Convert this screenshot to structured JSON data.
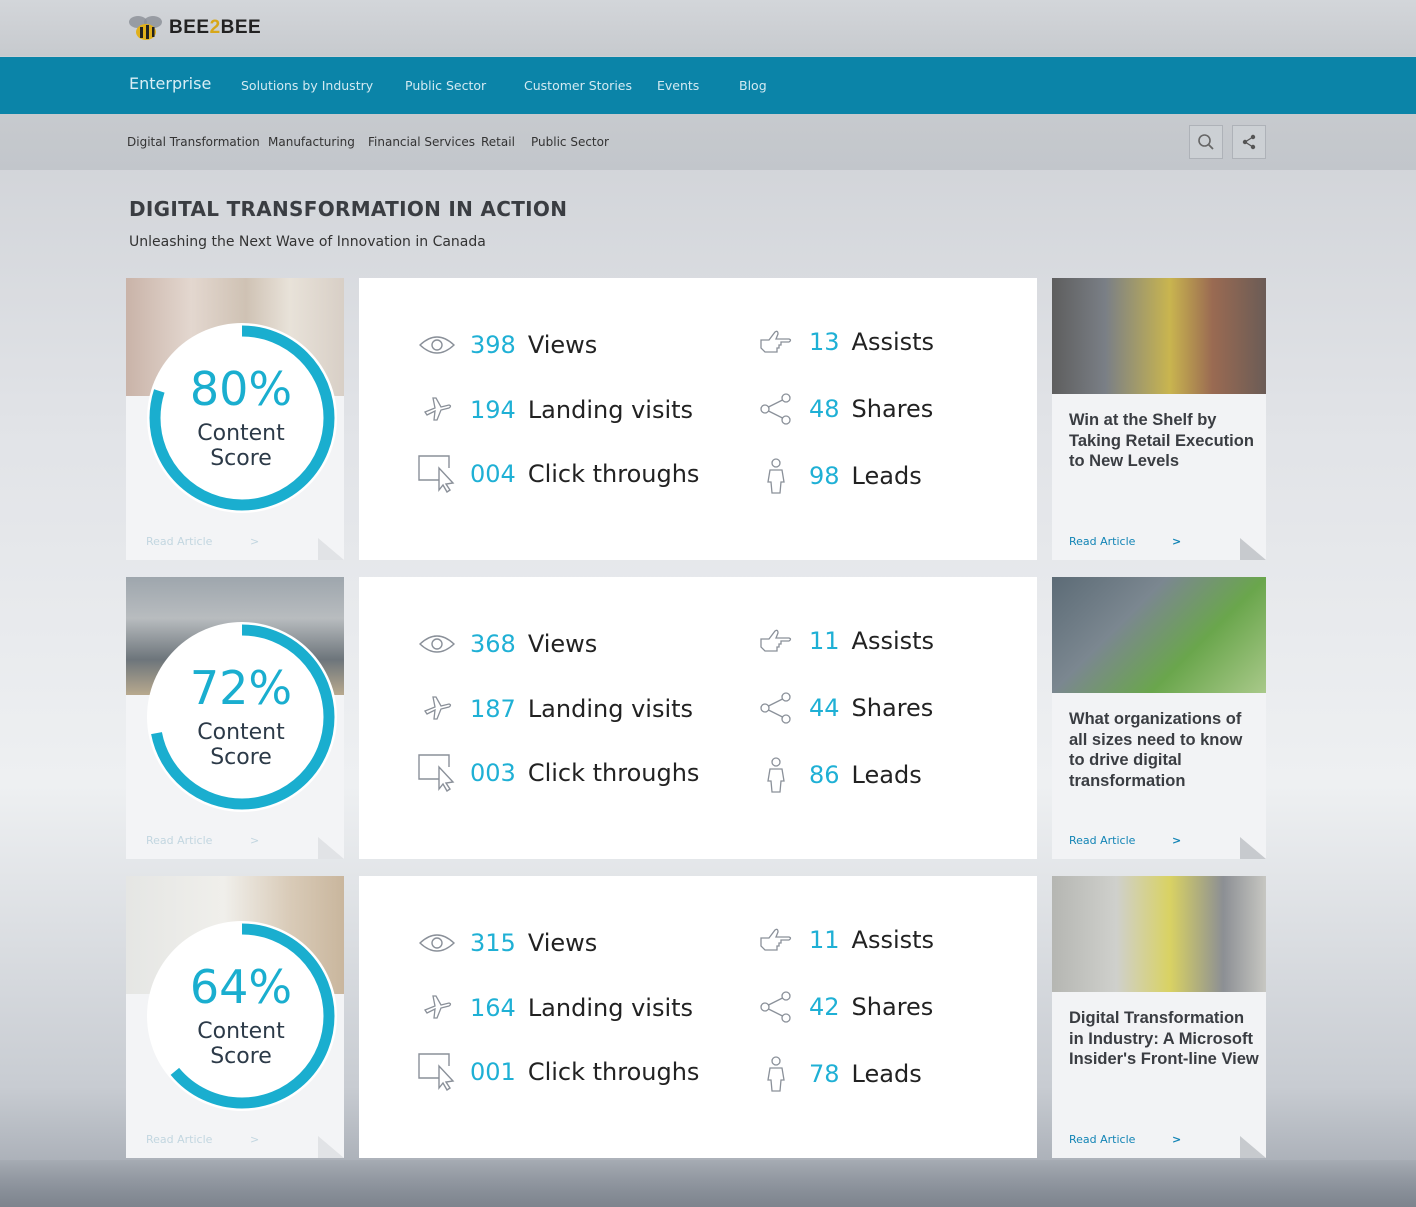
{
  "brand": {
    "logo_prefix": "BEE",
    "logo_mid": "2",
    "logo_suffix": "BEE"
  },
  "nav": {
    "brand": "Enterprise",
    "items": [
      "Solutions by Industry",
      "Public Sector",
      "Customer Stories",
      "Events",
      "Blog"
    ]
  },
  "subnav": {
    "items": [
      "Digital Transformation",
      "Manufacturing",
      "Financial Services",
      "Retail",
      "Public Sector"
    ],
    "search_icon": "search-icon",
    "share_icon": "share-icon"
  },
  "page": {
    "title": "DIGITAL TRANSFORMATION IN ACTION",
    "subtitle": "Unleashing the Next Wave of Innovation in Canada"
  },
  "rows": [
    {
      "score_pct": "80%",
      "score_value": 0.8,
      "score_label_1": "Content",
      "score_label_2": "Score",
      "stats": {
        "views": {
          "num": "398",
          "label": "Views"
        },
        "landing": {
          "num": "194",
          "label": "Landing visits"
        },
        "clicks": {
          "num": "004",
          "label": "Click throughs"
        },
        "assists": {
          "num": "13",
          "label": "Assists"
        },
        "shares": {
          "num": "48",
          "label": "Shares"
        },
        "leads": {
          "num": "98",
          "label": "Leads"
        }
      },
      "left_read": "Read Article",
      "right_title": "Win at the Shelf by Taking Retail Execution to New Levels",
      "right_read": "Read Article"
    },
    {
      "score_pct": "72%",
      "score_value": 0.72,
      "score_label_1": "Content",
      "score_label_2": "Score",
      "stats": {
        "views": {
          "num": "368",
          "label": "Views"
        },
        "landing": {
          "num": "187",
          "label": "Landing visits"
        },
        "clicks": {
          "num": "003",
          "label": "Click throughs"
        },
        "assists": {
          "num": "11",
          "label": "Assists"
        },
        "shares": {
          "num": "44",
          "label": "Shares"
        },
        "leads": {
          "num": "86",
          "label": "Leads"
        }
      },
      "left_read": "Read Article",
      "right_title": "What organizations of all sizes need to know to drive digital transformation",
      "right_read": "Read Article"
    },
    {
      "score_pct": "64%",
      "score_value": 0.64,
      "score_label_1": "Content",
      "score_label_2": "Score",
      "stats": {
        "views": {
          "num": "315",
          "label": "Views"
        },
        "landing": {
          "num": "164",
          "label": "Landing visits"
        },
        "clicks": {
          "num": "001",
          "label": "Click throughs"
        },
        "assists": {
          "num": "11",
          "label": "Assists"
        },
        "shares": {
          "num": "42",
          "label": "Shares"
        },
        "leads": {
          "num": "78",
          "label": "Leads"
        }
      },
      "left_read": "Read Article",
      "right_title": "Digital Transformation in Industry: A Microsoft Insider's Front-line View",
      "right_read": "Read Article"
    }
  ],
  "arrow": ">",
  "colors": {
    "accent": "#1aaecf",
    "nav": "#0b84a8",
    "link": "#1284b5"
  }
}
